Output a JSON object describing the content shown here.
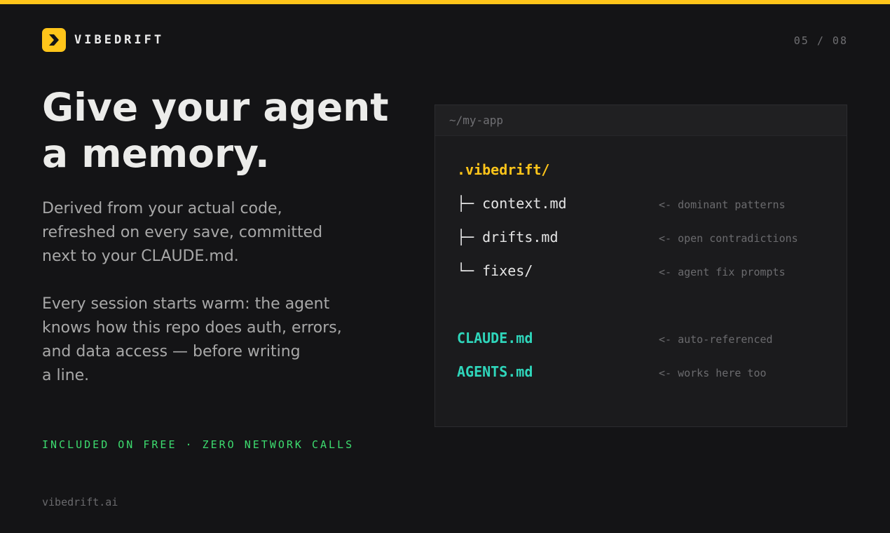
{
  "brand": {
    "name": "VIBEDRIFT",
    "logo_icon": "chevron-right-icon",
    "accent_color": "#ffc51a"
  },
  "pagination": {
    "label": "05 / 08"
  },
  "headline": {
    "line1": "Give your agent",
    "line2": "a memory."
  },
  "paragraphs": [
    {
      "lines": [
        "Derived from your actual code,",
        "refreshed on every save, committed",
        "next to your CLAUDE.md."
      ]
    },
    {
      "lines": [
        "Every session starts warm: the agent",
        "knows how this repo does auth, errors,",
        "and data access — before writing",
        "a line."
      ]
    }
  ],
  "tagline": "INCLUDED ON FREE · ZERO NETWORK CALLS",
  "footer": {
    "url": "vibedrift.ai"
  },
  "terminal": {
    "path": "~/my-app",
    "root_folder": ".vibedrift/",
    "tree": [
      {
        "branch": "├─",
        "name": "context.md",
        "comment": "<- dominant patterns"
      },
      {
        "branch": "├─",
        "name": "drifts.md",
        "comment": "<- open contradictions"
      },
      {
        "branch": "└─",
        "name": "fixes/",
        "comment": "<- agent fix prompts"
      }
    ],
    "docs": [
      {
        "name": "CLAUDE.md",
        "comment": "<- auto-referenced"
      },
      {
        "name": "AGENTS.md",
        "comment": "<- works here too"
      }
    ]
  },
  "colors": {
    "background": "#141416",
    "accent": "#ffc51a",
    "tagline": "#3ddc6f",
    "doc_file": "#2fd6bb"
  }
}
